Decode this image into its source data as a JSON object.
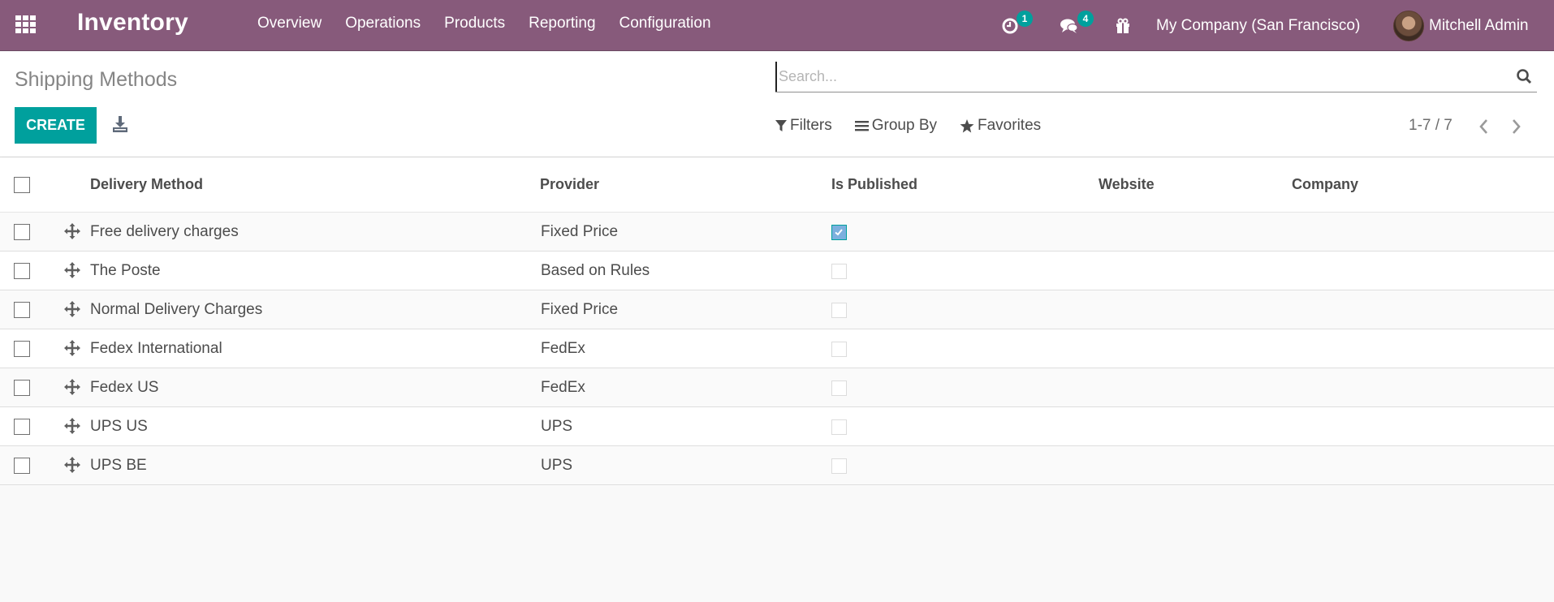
{
  "navbar": {
    "app_name": "Inventory",
    "menu": [
      "Overview",
      "Operations",
      "Products",
      "Reporting",
      "Configuration"
    ],
    "activity_count": "1",
    "message_count": "4",
    "company": "My Company (San Francisco)",
    "user": "Mitchell Admin",
    "bg_color": "#875a7b",
    "badge_color": "#00a09d"
  },
  "control": {
    "title": "Shipping Methods",
    "create_label": "CREATE",
    "search_placeholder": "Search...",
    "search_value": "",
    "filters_label": "Filters",
    "groupby_label": "Group By",
    "favorites_label": "Favorites",
    "pager": "1-7 / 7"
  },
  "table": {
    "columns": [
      "Delivery Method",
      "Provider",
      "Is Published",
      "Website",
      "Company"
    ],
    "rows": [
      {
        "name": "Free delivery charges",
        "provider": "Fixed Price",
        "published": true,
        "website": "",
        "company": ""
      },
      {
        "name": "The Poste",
        "provider": "Based on Rules",
        "published": false,
        "website": "",
        "company": ""
      },
      {
        "name": "Normal Delivery Charges",
        "provider": "Fixed Price",
        "published": false,
        "website": "",
        "company": ""
      },
      {
        "name": "Fedex International",
        "provider": "FedEx",
        "published": false,
        "website": "",
        "company": ""
      },
      {
        "name": "Fedex US",
        "provider": "FedEx",
        "published": false,
        "website": "",
        "company": ""
      },
      {
        "name": "UPS US",
        "provider": "UPS",
        "published": false,
        "website": "",
        "company": ""
      },
      {
        "name": "UPS BE",
        "provider": "UPS",
        "published": false,
        "website": "",
        "company": ""
      }
    ]
  }
}
